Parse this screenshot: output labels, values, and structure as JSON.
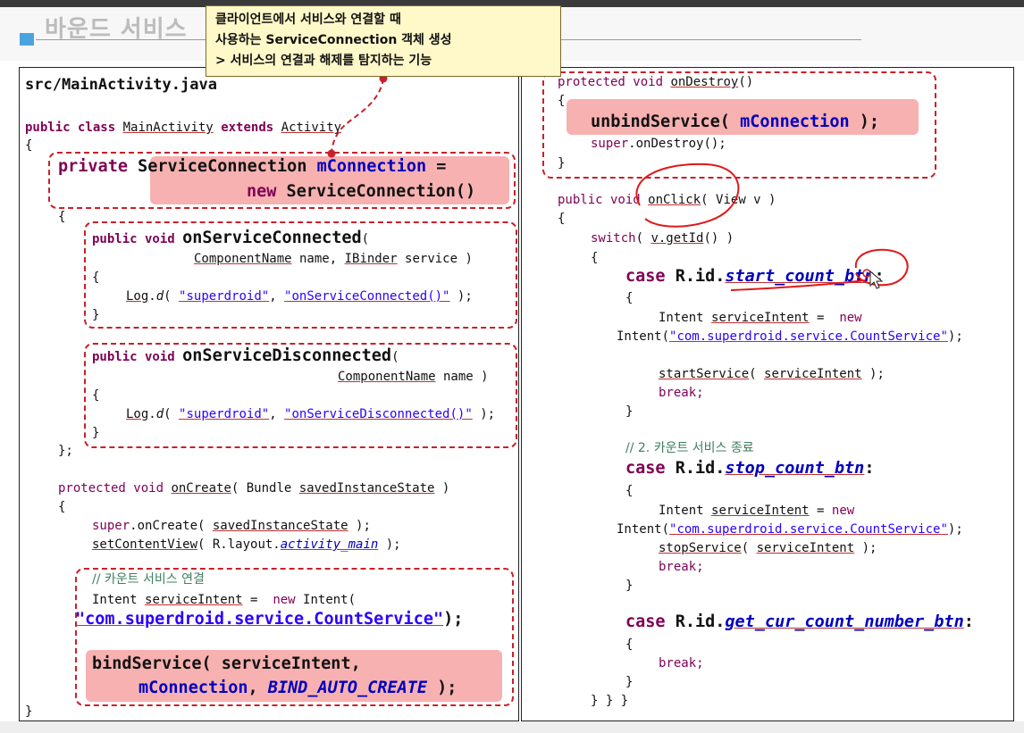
{
  "slide": {
    "title": "바운드 서비스"
  },
  "callout": {
    "lines": [
      "클라이언트에서 서비스와 연결할 때",
      "사용하는 ServiceConnection 객체 생성",
      "> 서비스의 연결과 해제를 탐지하는 기능"
    ]
  },
  "left_panel": {
    "file_name": "src/MainActivity.java",
    "lines": [
      "public class MainActivity extends Activity",
      "{",
      "private ServiceConnection mConnection =",
      "new ServiceConnection()",
      "{",
      "public void onServiceConnected(",
      "ComponentName name, IBinder service )",
      "{",
      "Log.d( \"superdroid\", \"onServiceConnected()\" );",
      "}",
      "public void onServiceDisconnected(",
      "ComponentName name )",
      "{",
      "Log.d( \"superdroid\", \"onServiceDisconnected()\" );",
      "}",
      "};",
      "protected void onCreate( Bundle savedInstanceState )",
      "{",
      "super.onCreate( savedInstanceState );",
      "setContentView( R.layout.activity_main );",
      "// 카운트 서비스 연결",
      "Intent serviceIntent =  new Intent(",
      "\"com.superdroid.service.CountService\");",
      "bindService( serviceIntent,",
      "mConnection, BIND_AUTO_CREATE );",
      "}"
    ]
  },
  "right_panel": {
    "lines": [
      "protected void onDestroy()",
      "{",
      "unbindService( mConnection );",
      "super.onDestroy();",
      "}",
      "public void onClick( View v )",
      "{",
      "switch( v.getId() )",
      "{",
      "case R.id.start_count_btn:",
      "{",
      "Intent serviceIntent =  new",
      "Intent(\"com.superdroid.service.CountService\");",
      "startService( serviceIntent );",
      "break;",
      "}",
      "// 2. 카운트 서비스 종료",
      "case R.id.stop_count_btn:",
      "{",
      "Intent serviceIntent = new",
      "Intent(\"com.superdroid.service.CountService\");",
      "stopService( serviceIntent );",
      "break;",
      "}",
      "case R.id.get_cur_count_number_btn:",
      "{",
      "break;",
      "}",
      "} } }"
    ]
  },
  "colors": {
    "keyword": "#7f0055",
    "string": "#2a00ff",
    "comment": "#3f7f5f",
    "highlight": "#f7b1b1",
    "annotation": "#c8202a",
    "callout_bg": "#fff8c9"
  }
}
